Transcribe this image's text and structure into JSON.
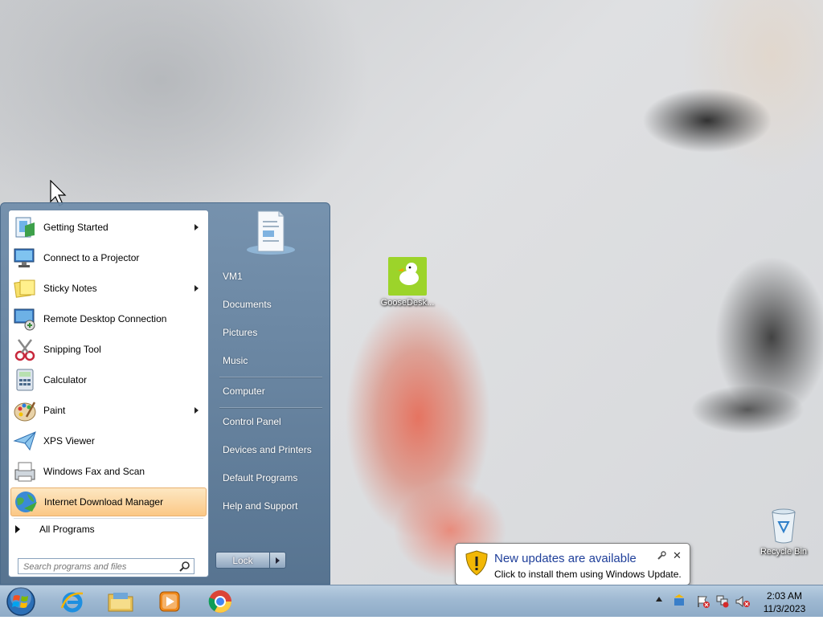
{
  "desktop": {
    "icons": [
      {
        "label": "GooseDesk..."
      },
      {
        "label": "Recycle Bin"
      }
    ]
  },
  "start_menu": {
    "programs": [
      {
        "label": "Getting Started",
        "submenu": true
      },
      {
        "label": "Connect to a Projector",
        "submenu": false
      },
      {
        "label": "Sticky Notes",
        "submenu": true
      },
      {
        "label": "Remote Desktop Connection",
        "submenu": false
      },
      {
        "label": "Snipping Tool",
        "submenu": false
      },
      {
        "label": "Calculator",
        "submenu": false
      },
      {
        "label": "Paint",
        "submenu": true
      },
      {
        "label": "XPS Viewer",
        "submenu": false
      },
      {
        "label": "Windows Fax and Scan",
        "submenu": false
      },
      {
        "label": "Internet Download Manager",
        "submenu": false,
        "highlighted": true
      }
    ],
    "all_programs": "All Programs",
    "search_placeholder": "Search programs and files",
    "right_links": [
      "VM1",
      "Documents",
      "Pictures",
      "Music",
      "Computer",
      "Control Panel",
      "Devices and Printers",
      "Default Programs",
      "Help and Support"
    ],
    "lock_label": "Lock"
  },
  "notification": {
    "title": "New updates are available",
    "body": "Click to install them using Windows Update."
  },
  "taskbar": {
    "pinned": [
      "start-orb",
      "internet-explorer",
      "windows-explorer",
      "media-player",
      "chrome"
    ],
    "clock_time": "2:03 AM",
    "clock_date": "11/3/2023"
  }
}
